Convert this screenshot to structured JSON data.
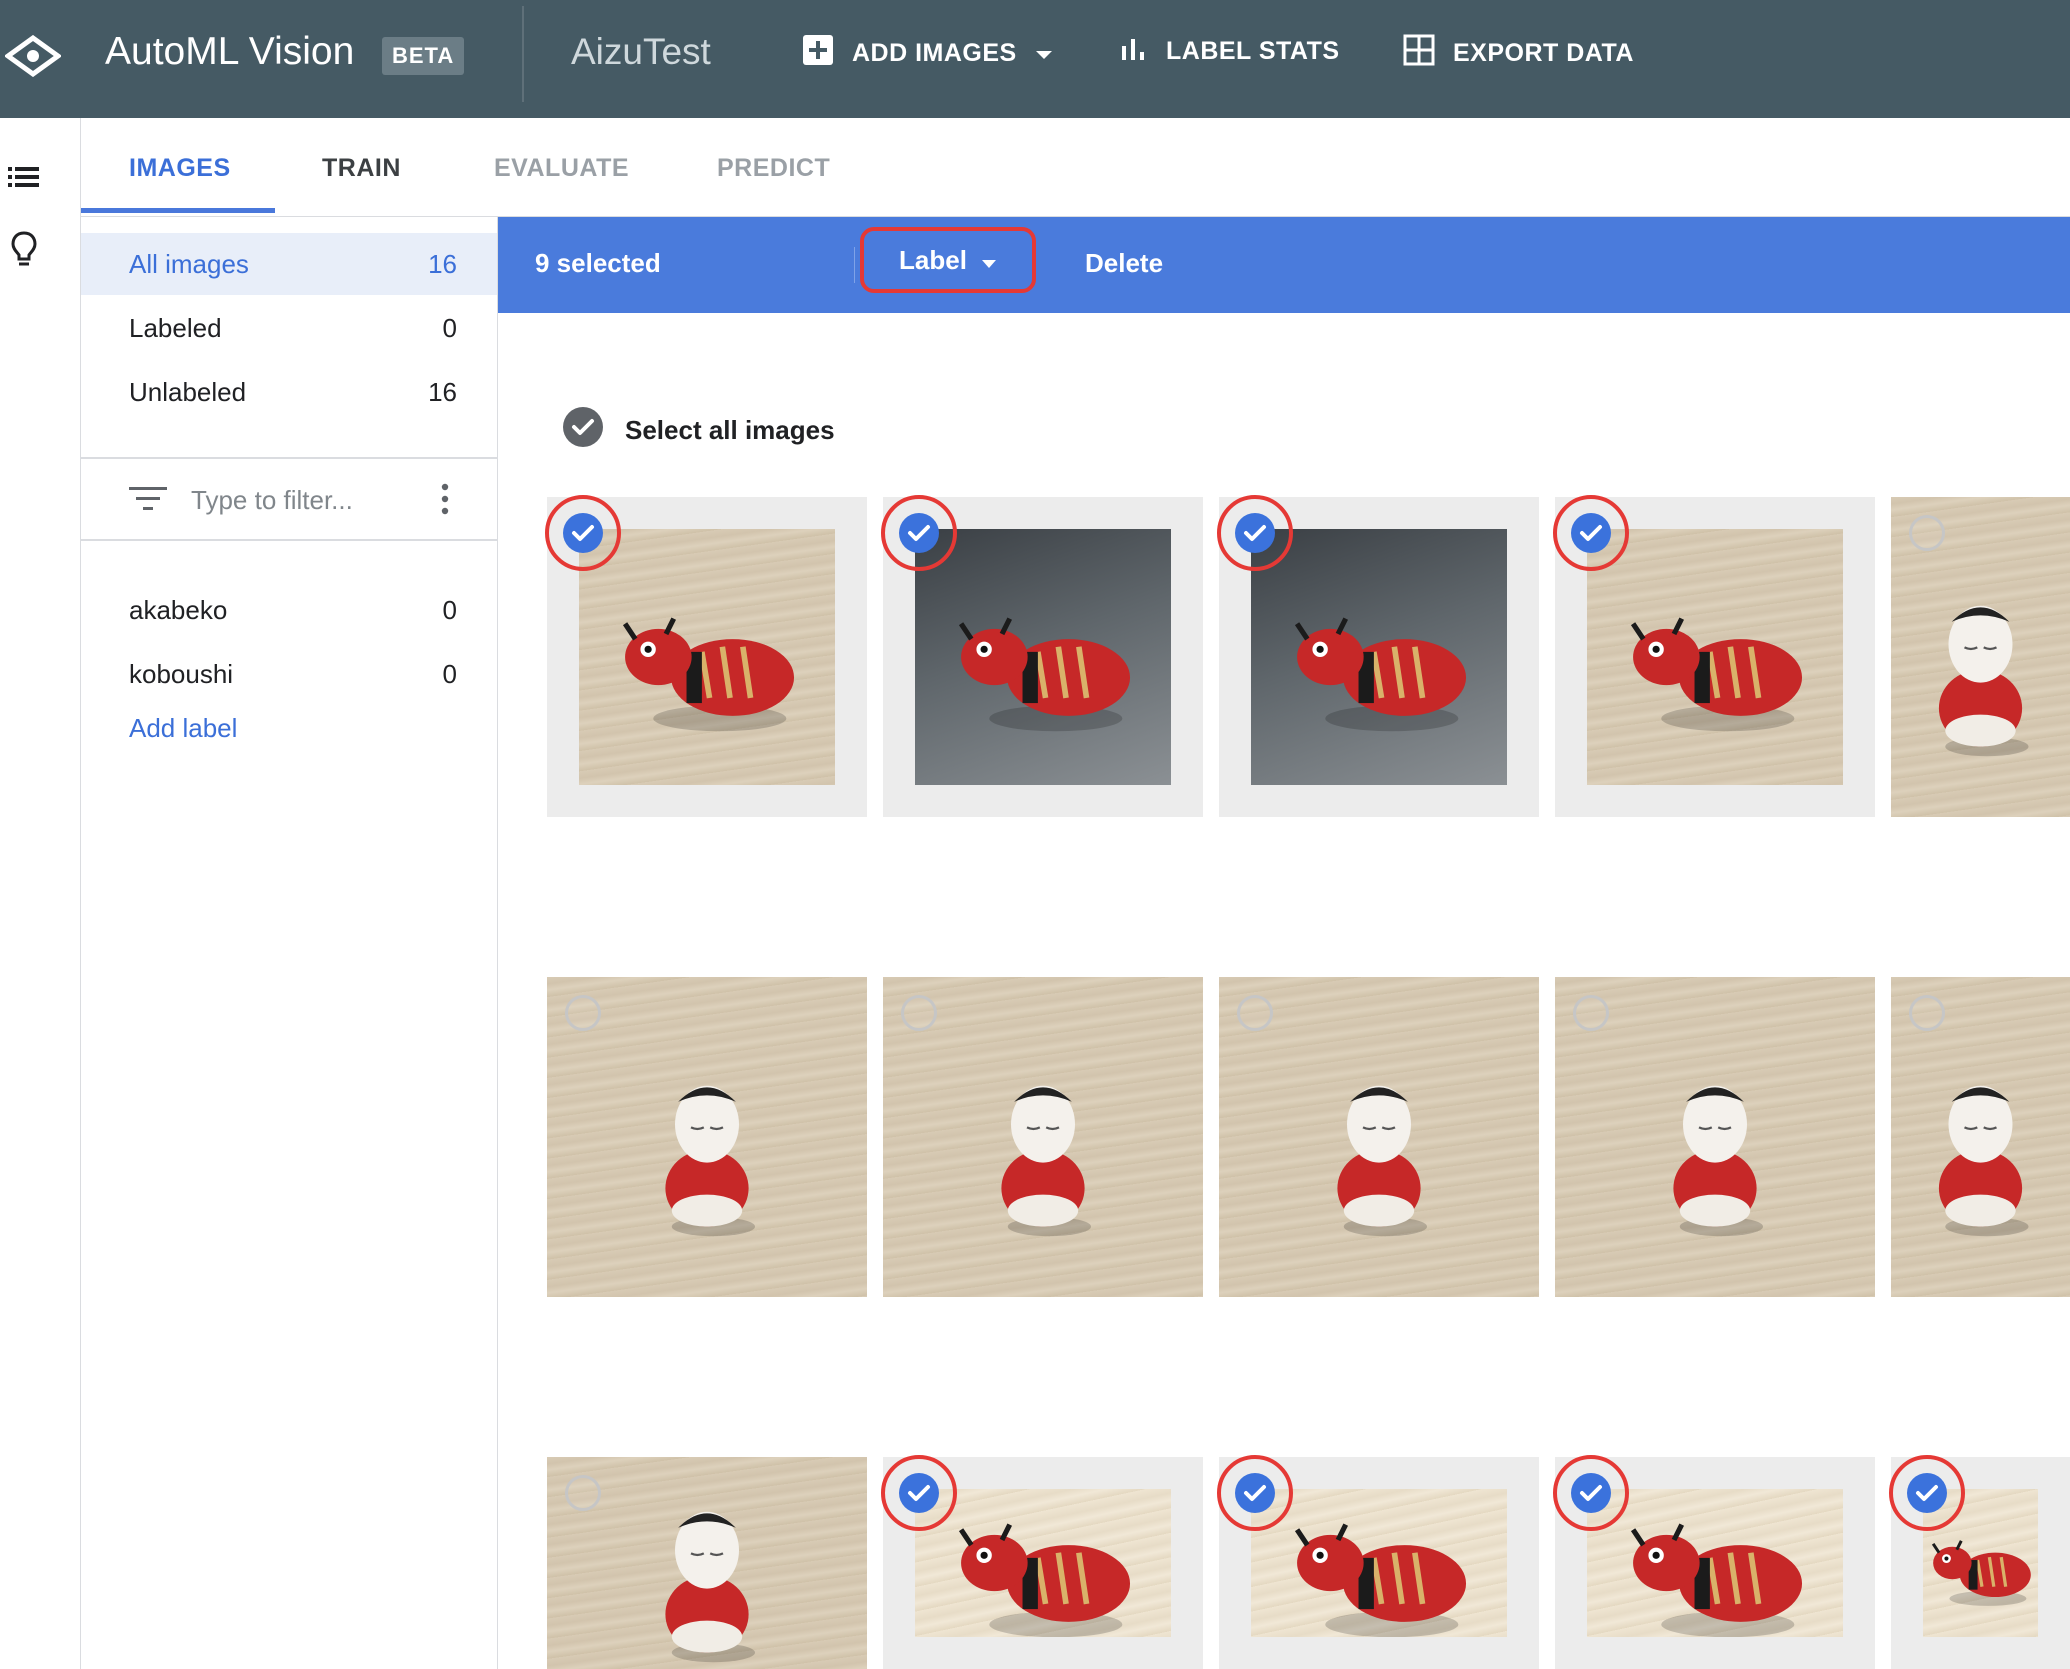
{
  "header": {
    "app_name": "AutoML Vision",
    "badge": "BETA",
    "project": "AizuTest",
    "actions": {
      "add_images": "ADD IMAGES",
      "label_stats": "LABEL STATS",
      "export_data": "EXPORT DATA"
    }
  },
  "tabs": {
    "images": "IMAGES",
    "train": "TRAIN",
    "evaluate": "EVALUATE",
    "predict": "PREDICT",
    "active": "IMAGES"
  },
  "sidebar": {
    "filters": [
      {
        "label": "All images",
        "count": "16",
        "active": true
      },
      {
        "label": "Labeled",
        "count": "0"
      },
      {
        "label": "Unlabeled",
        "count": "16"
      }
    ],
    "filter_placeholder": "Type to filter...",
    "labels": [
      {
        "label": "akabeko",
        "count": "0"
      },
      {
        "label": "koboushi",
        "count": "0"
      }
    ],
    "add_label": "Add label"
  },
  "selection_bar": {
    "count_text": "9 selected",
    "label_button": "Label",
    "delete_button": "Delete"
  },
  "select_all": "Select all images",
  "colors": {
    "header_bg": "#455a64",
    "accent": "#4a7bdc",
    "highlight": "#e53935"
  },
  "grid": {
    "rows": [
      [
        {
          "subject": "akabeko",
          "selected": true
        },
        {
          "subject": "akabeko",
          "selected": true
        },
        {
          "subject": "akabeko",
          "selected": true
        },
        {
          "subject": "akabeko",
          "selected": true
        },
        {
          "subject": "koboushi",
          "selected": false
        }
      ],
      [
        {
          "subject": "koboushi",
          "selected": false
        },
        {
          "subject": "koboushi",
          "selected": false
        },
        {
          "subject": "koboushi",
          "selected": false
        },
        {
          "subject": "koboushi",
          "selected": false
        },
        {
          "subject": "koboushi",
          "selected": false
        }
      ],
      [
        {
          "subject": "koboushi",
          "selected": false
        },
        {
          "subject": "akabeko",
          "selected": true
        },
        {
          "subject": "akabeko",
          "selected": true
        },
        {
          "subject": "akabeko",
          "selected": true
        },
        {
          "subject": "akabeko",
          "selected": true
        }
      ]
    ]
  }
}
